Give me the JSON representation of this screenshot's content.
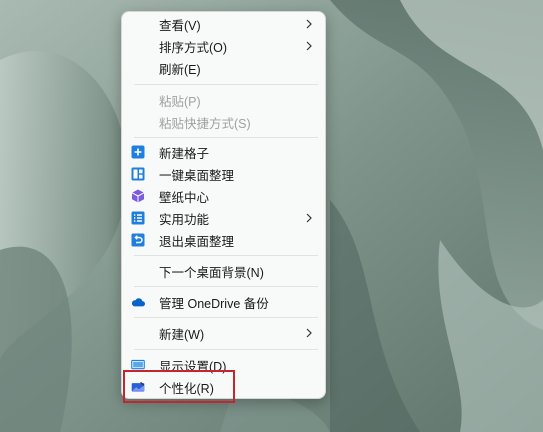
{
  "menu": {
    "view_label": "查看(V)",
    "sort_label": "排序方式(O)",
    "refresh_label": "刷新(E)",
    "paste_label": "粘贴(P)",
    "paste_shortcut_label": "粘贴快捷方式(S)",
    "new_grid_label": "新建格子",
    "organize_desktop_label": "一键桌面整理",
    "wallpaper_center_label": "壁纸中心",
    "utilities_label": "实用功能",
    "exit_organize_label": "退出桌面整理",
    "next_background_label": "下一个桌面背景(N)",
    "onedrive_label": "管理 OneDrive 备份",
    "new_label": "新建(W)",
    "display_settings_label": "显示设置(D)",
    "personalize_label": "个性化(R)"
  },
  "icons": {
    "new_grid": "plus-square-icon",
    "organize_desktop": "layout-grid-icon",
    "wallpaper_center": "cube-icon",
    "utilities": "list-icon",
    "exit_organize": "undo-icon",
    "onedrive": "cloud-icon",
    "display_settings": "monitor-icon",
    "personalize": "personalize-icon"
  },
  "colors": {
    "icon_blue": "#1f7fe0",
    "purple": "#7b5ce0",
    "onedrive_blue": "#0a64c8",
    "highlight_red": "#c4262e"
  }
}
